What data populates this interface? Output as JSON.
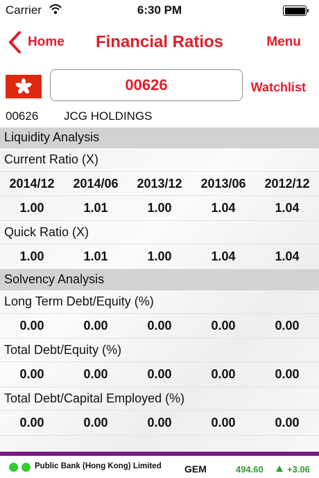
{
  "status_bar": {
    "carrier": "Carrier",
    "time": "6:30 PM",
    "wifi_icon": "wifi-icon",
    "battery_icon": "battery-icon"
  },
  "nav": {
    "back_label": "Home",
    "title": "Financial Ratios",
    "menu_label": "Menu"
  },
  "search": {
    "flag_icon": "hong-kong-flag-icon",
    "code_value": "00626",
    "watchlist_label": "Watchlist"
  },
  "stock": {
    "code": "00626",
    "name": "JCG HOLDINGS"
  },
  "periods": [
    "2014/12",
    "2014/06",
    "2013/12",
    "2013/06",
    "2012/12"
  ],
  "sections": [
    {
      "title": "Liquidity Analysis",
      "ratios": [
        {
          "label": "Current Ratio (X)",
          "show_periods": true,
          "values": [
            "1.00",
            "1.01",
            "1.00",
            "1.04",
            "1.04"
          ]
        },
        {
          "label": "Quick Ratio (X)",
          "show_periods": false,
          "values": [
            "1.00",
            "1.01",
            "1.00",
            "1.04",
            "1.04"
          ]
        }
      ]
    },
    {
      "title": "Solvency Analysis",
      "ratios": [
        {
          "label": "Long Term Debt/Equity (%)",
          "show_periods": false,
          "values": [
            "0.00",
            "0.00",
            "0.00",
            "0.00",
            "0.00"
          ]
        },
        {
          "label": "Total Debt/Equity (%)",
          "show_periods": false,
          "values": [
            "0.00",
            "0.00",
            "0.00",
            "0.00",
            "0.00"
          ]
        },
        {
          "label": "Total Debt/Capital Employed (%)",
          "show_periods": false,
          "values": [
            "0.00",
            "0.00",
            "0.00",
            "0.00",
            "0.00"
          ]
        }
      ]
    }
  ],
  "ticker": {
    "bank_name": "Public Bank (Hong Kong) Limited",
    "board": "GEM",
    "price": "494.60",
    "change": "+3.06",
    "up_color": "#2c9e2c"
  },
  "colors": {
    "accent": "#e11d2a",
    "section_bg": "#d2d2d2",
    "ticker_stripe": "#7a1a85"
  }
}
